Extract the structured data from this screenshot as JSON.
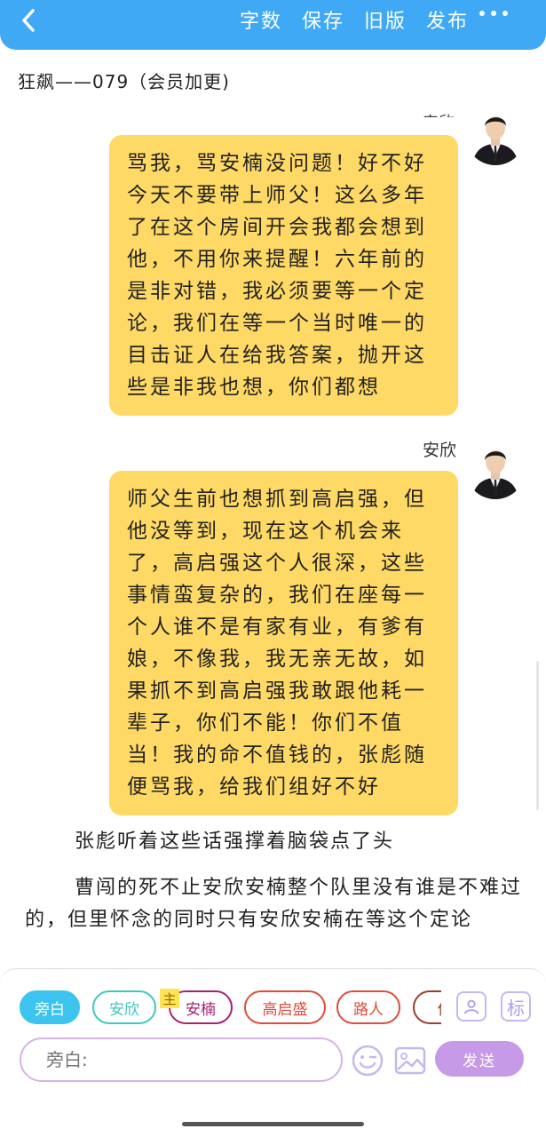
{
  "header": {
    "back_icon": "chevron-left-icon",
    "actions": [
      "字数",
      "保存",
      "旧版",
      "发布"
    ],
    "more_icon": "more-dots-icon",
    "color": "#3fa9f5"
  },
  "document": {
    "title": "狂飙——079（会员加更)"
  },
  "messages": [
    {
      "speaker_partial": "安欣",
      "text": "骂我，骂安楠没问题！好不好今天不要带上师父！这么多年了在这个房间开会我都会想到他，不用你来提醒！六年前的是非对错，我必须要等一个定论，我们在等一个当时唯一的目击证人在给我答案，抛开这些是非我也想，你们都想"
    },
    {
      "speaker": "安欣",
      "text": "师父生前也想抓到高启强，但他没等到，现在这个机会来了，高启强这个人很深，这些事情蛮复杂的，我们在座每一个人谁不是有家有业，有爹有娘，不像我，我无亲无故，如果抓不到高启强我敢跟他耗一辈子，你们不能！你们不值当！我的命不值钱的，张彪随便骂我，给我们组好不好"
    }
  ],
  "narration": [
    "张彪听着这些话强撑着脑袋点了头",
    "曹闯的死不止安欣安楠整个队里没有谁是不难过的，但里怀念的同时只有安欣安楠在等这个定论"
  ],
  "composer": {
    "roles": [
      {
        "label": "旁白",
        "color": "#3cc4ee",
        "active": true
      },
      {
        "label": "安欣",
        "color": "#3fc7c0",
        "active": false
      },
      {
        "label": "安楠",
        "color": "#a8206e",
        "active": false
      },
      {
        "label": "高启盛",
        "color": "#e04b3a",
        "active": false
      },
      {
        "label": "路人",
        "color": "#e04b3a",
        "active": false
      },
      {
        "label": "作",
        "color": "#9a3d2a",
        "active": false
      }
    ],
    "main_badge": "主",
    "role_manager_icon": "person-card-icon",
    "tag_label": "标",
    "input_placeholder": "旁白:",
    "emoji_icon": "emoji-wink-icon",
    "image_icon": "image-icon",
    "send_label": "发送",
    "accent": "#c79ae8"
  }
}
